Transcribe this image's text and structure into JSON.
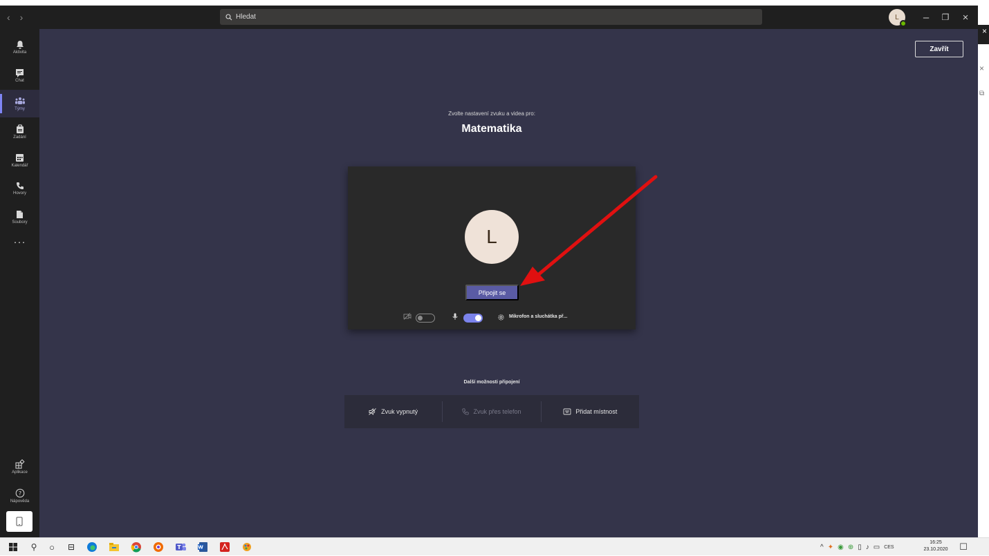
{
  "topbar": {
    "back_icon": "chevron-left-icon",
    "forward_icon": "chevron-right-icon",
    "search_placeholder": "Hledat",
    "user_initial": "L",
    "minimize": "–",
    "restore": "❐",
    "close": "×"
  },
  "sidebar": {
    "items": [
      {
        "label": "Aktivita",
        "icon": "bell-icon"
      },
      {
        "label": "Chat",
        "icon": "chat-icon"
      },
      {
        "label": "Týmy",
        "icon": "teams-icon",
        "active": true
      },
      {
        "label": "Zadání",
        "icon": "assignments-icon"
      },
      {
        "label": "Kalendář",
        "icon": "calendar-icon"
      },
      {
        "label": "Hovory",
        "icon": "phone-icon"
      },
      {
        "label": "Soubory",
        "icon": "files-icon"
      }
    ],
    "more": "···",
    "bottom": [
      {
        "label": "Aplikace",
        "icon": "apps-icon"
      },
      {
        "label": "Nápověda",
        "icon": "help-icon"
      }
    ]
  },
  "main": {
    "close_label": "Zavřít",
    "prompt": "Zvolte nastavení zvuku a videa pro:",
    "meeting_title": "Matematika",
    "preview": {
      "avatar_initial": "L",
      "join_label": "Připojit se",
      "camera_on": false,
      "mic_on": true,
      "device_label": "Mikrofon a sluchátka př..."
    },
    "more_options_title": "Další možnosti připojení",
    "options": [
      {
        "label": "Zvuk vypnutý",
        "icon": "speaker-off-icon",
        "enabled": true
      },
      {
        "label": "Zvuk přes telefon",
        "icon": "phone-icon",
        "enabled": false
      },
      {
        "label": "Přidat místnost",
        "icon": "room-icon",
        "enabled": true
      }
    ]
  },
  "taskbar": {
    "tray_lang": "CES",
    "time": "16:25",
    "date": "23.10.2020"
  },
  "colors": {
    "rail": "#1f1f1f",
    "main_bg": "#34344a",
    "accent": "#5a5ba4",
    "toggle_on": "#7b83eb",
    "annotation_arrow": "#e01010"
  }
}
